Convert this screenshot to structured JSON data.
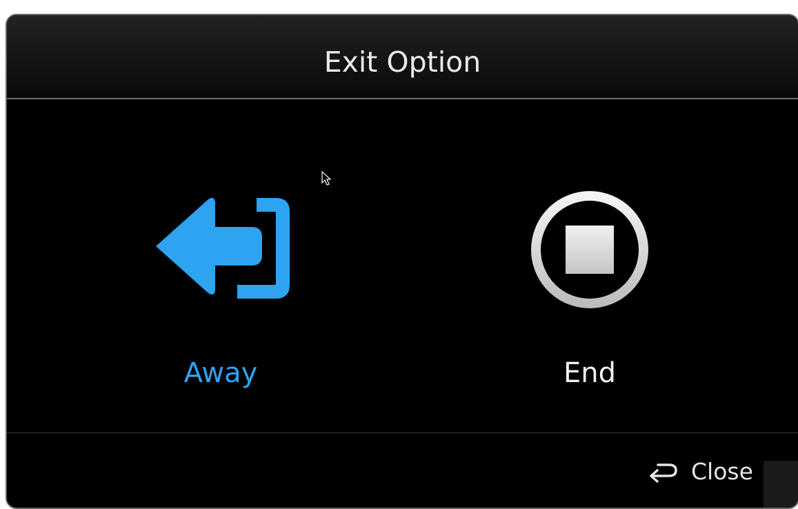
{
  "dialog": {
    "title": "Exit Option",
    "options": [
      {
        "label": "Away",
        "icon": "exit-arrow-icon",
        "color": "#2ea3f2"
      },
      {
        "label": "End",
        "icon": "stop-circle-icon",
        "color": "#f2f2f2"
      }
    ],
    "close_label": "Close",
    "close_icon": "return-arrow-icon"
  }
}
